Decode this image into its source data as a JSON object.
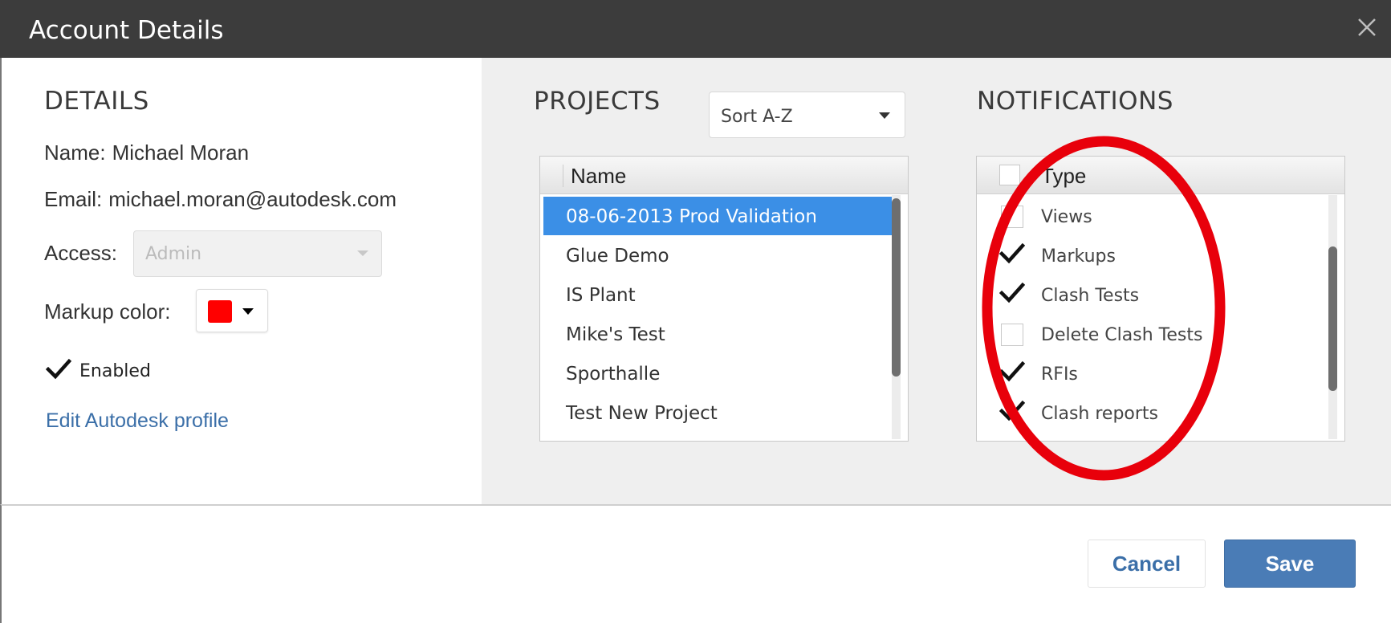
{
  "dialog": {
    "title": "Account Details"
  },
  "details": {
    "heading": "DETAILS",
    "name_label": "Name:",
    "name_value": "Michael Moran",
    "email_label": "Email:",
    "email_value": "michael.moran@autodesk.com",
    "access_label": "Access:",
    "access_value": "Admin",
    "markup_color_label": "Markup color:",
    "markup_color": "#ff0000",
    "enabled_label": "Enabled",
    "enabled_checked": true,
    "profile_link": "Edit Autodesk profile"
  },
  "projects": {
    "heading": "PROJECTS",
    "sort_value": "Sort A-Z",
    "column": "Name",
    "items": [
      {
        "label": "08-06-2013 Prod Validation",
        "selected": true
      },
      {
        "label": "Glue Demo",
        "selected": false
      },
      {
        "label": "IS Plant",
        "selected": false
      },
      {
        "label": "Mike's Test",
        "selected": false
      },
      {
        "label": "Sporthalle",
        "selected": false
      },
      {
        "label": "Test New Project",
        "selected": false
      }
    ]
  },
  "notifications": {
    "heading": "NOTIFICATIONS",
    "column": "Type",
    "items": [
      {
        "label": "Views",
        "checked": false
      },
      {
        "label": "Markups",
        "checked": true
      },
      {
        "label": "Clash Tests",
        "checked": true
      },
      {
        "label": "Delete Clash Tests",
        "checked": false
      },
      {
        "label": "RFIs",
        "checked": true
      },
      {
        "label": "Clash reports",
        "checked": true
      }
    ]
  },
  "footer": {
    "cancel_label": "Cancel",
    "save_label": "Save"
  },
  "colors": {
    "accent": "#4a7cb6",
    "selection": "#3b8fe6",
    "annotation": "#e8000b",
    "titlebar": "#3c3c3c"
  }
}
